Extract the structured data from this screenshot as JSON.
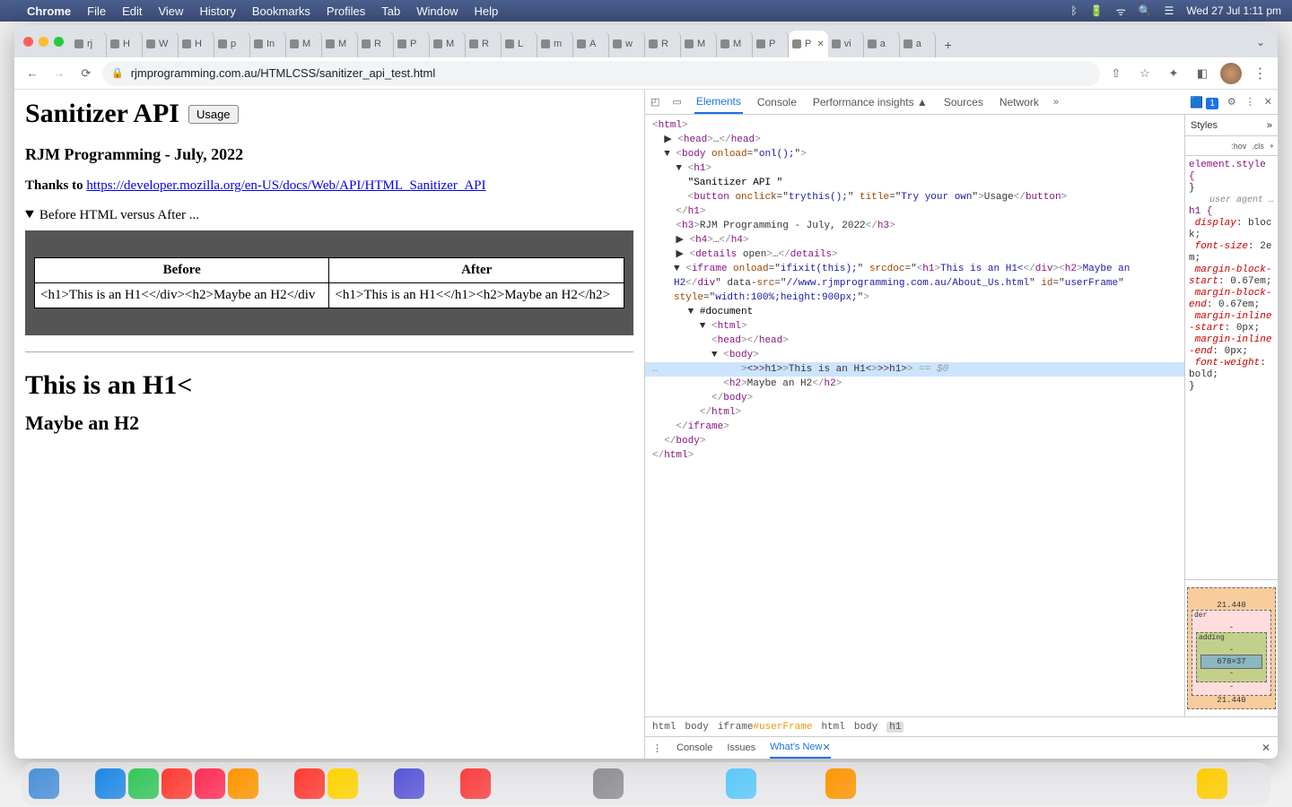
{
  "menubar": {
    "app": "Chrome",
    "items": [
      "File",
      "Edit",
      "View",
      "History",
      "Bookmarks",
      "Profiles",
      "Tab",
      "Window",
      "Help"
    ],
    "clock": "Wed 27 Jul  1:11 pm"
  },
  "tabs": {
    "list": [
      {
        "label": "rj"
      },
      {
        "label": "H"
      },
      {
        "label": "W"
      },
      {
        "label": "H"
      },
      {
        "label": "p"
      },
      {
        "label": "In"
      },
      {
        "label": "M"
      },
      {
        "label": "M"
      },
      {
        "label": "R"
      },
      {
        "label": "P"
      },
      {
        "label": "M"
      },
      {
        "label": "R"
      },
      {
        "label": "L"
      },
      {
        "label": "m"
      },
      {
        "label": "A"
      },
      {
        "label": "w"
      },
      {
        "label": "R"
      },
      {
        "label": "M"
      },
      {
        "label": "M"
      },
      {
        "label": "P"
      },
      {
        "label": "P"
      },
      {
        "label": "vi"
      },
      {
        "label": "a"
      },
      {
        "label": "a"
      }
    ],
    "active_index": 20
  },
  "omnibox": {
    "url": "rjmprogramming.com.au/HTMLCSS/sanitizer_api_test.html"
  },
  "page": {
    "h1": "Sanitizer API",
    "usage_btn": "Usage",
    "h3": "RJM Programming - July, 2022",
    "thanks_prefix": "Thanks to ",
    "thanks_link": "https://developer.mozilla.org/en-US/docs/Web/API/HTML_Sanitizer_API",
    "details_summary": "Before HTML versus After ...",
    "table": {
      "head": [
        "Before",
        "After"
      ],
      "row": [
        "<h1>This is an H1<</div><h2>Maybe an H2</div",
        "<h1>This is an H1<</h1><h2>Maybe an H2</h2>"
      ]
    },
    "iframe_h1": "This is an H1<",
    "iframe_h2": "Maybe an H2"
  },
  "devtools": {
    "tabs": [
      "Elements",
      "Console",
      "Performance insights ▲",
      "Sources",
      "Network"
    ],
    "active_tab": "Elements",
    "issue_count": "1",
    "styles": {
      "title": "Styles",
      "hov": ":hov",
      "cls": ".cls",
      "element_style": "element.style {",
      "ua_label": "user agent …",
      "selector": "h1 {",
      "props": [
        {
          "p": "display",
          "v": "block"
        },
        {
          "p": "font-size",
          "v": "2em"
        },
        {
          "p": "margin-block-start",
          "v": "0.67em"
        },
        {
          "p": "margin-block-end",
          "v": "0.67em"
        },
        {
          "p": "margin-inline-start",
          "v": "0px"
        },
        {
          "p": "margin-inline-end",
          "v": "0px"
        },
        {
          "p": "font-weight",
          "v": "bold"
        }
      ]
    },
    "boxmodel": {
      "margin_top": "21.440",
      "margin_bottom": "21.440",
      "border_lbl": "der",
      "padding_lbl": "adding",
      "content": "678×37",
      "dash": "-"
    },
    "dom_lines": [
      {
        "ind": 0,
        "pre": "",
        "raw": "<html>",
        "type": "open"
      },
      {
        "ind": 1,
        "pre": "▶ ",
        "raw": "<head>…</head>",
        "type": "closed"
      },
      {
        "ind": 1,
        "pre": "▼ ",
        "raw": "<body onload=\"onl();\">",
        "type": "open"
      },
      {
        "ind": 2,
        "pre": "▼ ",
        "raw": "<h1>",
        "type": "open"
      },
      {
        "ind": 3,
        "pre": "",
        "raw": "\"Sanitizer API \"",
        "type": "text"
      },
      {
        "ind": 3,
        "pre": "",
        "raw": "<button onclick=\"trythis();\" title=\"Try your own\">Usage</button>",
        "type": "closed"
      },
      {
        "ind": 2,
        "pre": "",
        "raw": "</h1>",
        "type": "close"
      },
      {
        "ind": 2,
        "pre": "",
        "raw": "<h3>RJM Programming - July, 2022</h3>",
        "type": "closed"
      },
      {
        "ind": 2,
        "pre": "▶ ",
        "raw": "<h4>…</h4>",
        "type": "closed"
      },
      {
        "ind": 2,
        "pre": "▶ ",
        "raw": "<details open>…</details>",
        "type": "closed"
      },
      {
        "ind": 2,
        "pre": "▼ ",
        "raw": "<iframe onload=\"ifixit(this);\" srcdoc=\"<h1>This is an H1<</div><h2>Maybe an H2</div\" data-src=\"//www.rjmprogramming.com.au/About_Us.html\" id=\"userFrame\" style=\"width:100%;height:900px;\">",
        "type": "wrap"
      },
      {
        "ind": 3,
        "pre": "▼ ",
        "raw": "#document",
        "type": "doc"
      },
      {
        "ind": 4,
        "pre": "▼ ",
        "raw": "<html>",
        "type": "open"
      },
      {
        "ind": 5,
        "pre": "",
        "raw": "<head></head>",
        "type": "closed"
      },
      {
        "ind": 5,
        "pre": "▼ ",
        "raw": "<body>",
        "type": "open"
      },
      {
        "ind": 6,
        "pre": "",
        "raw": "<h1>This is an H1<</h1> == $0",
        "type": "selected"
      },
      {
        "ind": 6,
        "pre": "",
        "raw": "<h2>Maybe an H2</h2>",
        "type": "closed"
      },
      {
        "ind": 5,
        "pre": "",
        "raw": "</body>",
        "type": "close"
      },
      {
        "ind": 4,
        "pre": "",
        "raw": "</html>",
        "type": "close"
      },
      {
        "ind": 2,
        "pre": "",
        "raw": "</iframe>",
        "type": "close"
      },
      {
        "ind": 1,
        "pre": "",
        "raw": "</body>",
        "type": "close"
      },
      {
        "ind": 0,
        "pre": "",
        "raw": "</html>",
        "type": "close"
      }
    ],
    "breadcrumb": [
      "html",
      "body",
      "iframe#userFrame",
      "html",
      "body",
      "h1"
    ],
    "drawer_tabs": [
      "Console",
      "Issues",
      "What's New"
    ],
    "drawer_active": "What's New"
  },
  "dock_colors": [
    "#4a90d9",
    "#7a8",
    "#1e88e5",
    "#34c759",
    "#ff3b30",
    "#ff2d55",
    "#ff9500",
    "#fff",
    "#ff3b30",
    "#ffd400",
    "#a0a",
    "#5856d6",
    "#000",
    "#fa3e3e",
    "#111",
    "#4a4",
    "#c33",
    "#8e8e93",
    "#c33",
    "#333",
    "#965",
    "#5ac8fa",
    "#333",
    "#e9e",
    "#ff9500",
    "#0a4",
    "#8e8",
    "#f06",
    "#555",
    "#999",
    "#28f",
    "#888",
    "#888",
    "#07f",
    "#36c",
    "#ffcc00",
    "#f63",
    "#ddd",
    "#bbb",
    "#888"
  ]
}
